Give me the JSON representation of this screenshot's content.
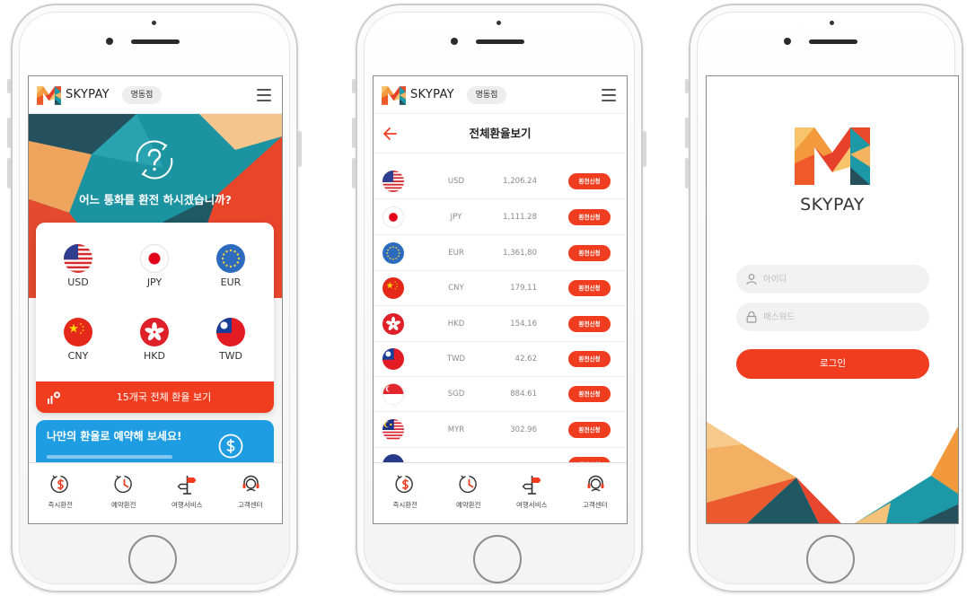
{
  "header": {
    "brand": "SKYPAY",
    "branch": "명동점",
    "logo_icon": "skypay-m-logo-icon",
    "menu_icon": "hamburger-menu-icon"
  },
  "home_screen": {
    "hero": {
      "question": "어느 통화를 환전 하시겠습니까?",
      "icon": "currency-question-icon"
    },
    "currencies": [
      {
        "code": "USD",
        "icon": "flag-usa-icon"
      },
      {
        "code": "JPY",
        "icon": "flag-japan-icon"
      },
      {
        "code": "EUR",
        "icon": "flag-eu-icon"
      },
      {
        "code": "CNY",
        "icon": "flag-china-icon"
      },
      {
        "code": "HKD",
        "icon": "flag-hong-kong-icon"
      },
      {
        "code": "TWD",
        "icon": "flag-taiwan-icon"
      }
    ],
    "all_rates_button": "15개국 전체 환율 보기",
    "banner_title": "나만의 환율로 예약해 보세요!"
  },
  "tabs": [
    {
      "label": "즉시환전",
      "icon": "instant-exchange-icon"
    },
    {
      "label": "예약환전",
      "icon": "reserved-exchange-icon"
    },
    {
      "label": "여행서비스",
      "icon": "travel-service-icon"
    },
    {
      "label": "고객센터",
      "icon": "customer-center-icon"
    }
  ],
  "rates_screen": {
    "title": "전체환율보기",
    "back_icon": "back-arrow-icon",
    "apply_label": "환전신청",
    "rows": [
      {
        "code": "USD",
        "rate": "1,206.24",
        "icon": "flag-usa-icon"
      },
      {
        "code": "JPY",
        "rate": "1,111.28",
        "icon": "flag-japan-icon"
      },
      {
        "code": "EUR",
        "rate": "1,361,80",
        "icon": "flag-eu-icon"
      },
      {
        "code": "CNY",
        "rate": "179,11",
        "icon": "flag-china-icon"
      },
      {
        "code": "HKD",
        "rate": "154,16",
        "icon": "flag-hong-kong-icon"
      },
      {
        "code": "TWD",
        "rate": "42.62",
        "icon": "flag-taiwan-icon"
      },
      {
        "code": "SGD",
        "rate": "884.61",
        "icon": "flag-singapore-icon"
      },
      {
        "code": "MYR",
        "rate": "302.96",
        "icon": "flag-malaysia-icon"
      }
    ]
  },
  "login_screen": {
    "brand": "SKYPAY",
    "id_placeholder": "아이디",
    "password_placeholder": "패스워드",
    "login_button": "로그인",
    "id_icon": "user-icon",
    "password_icon": "lock-icon"
  },
  "colors": {
    "accent_red": "#f03d20",
    "banner_blue": "#1f9de2",
    "teal": "#1c96a3",
    "dark_teal": "#25505d",
    "orange": "#efa45e"
  }
}
